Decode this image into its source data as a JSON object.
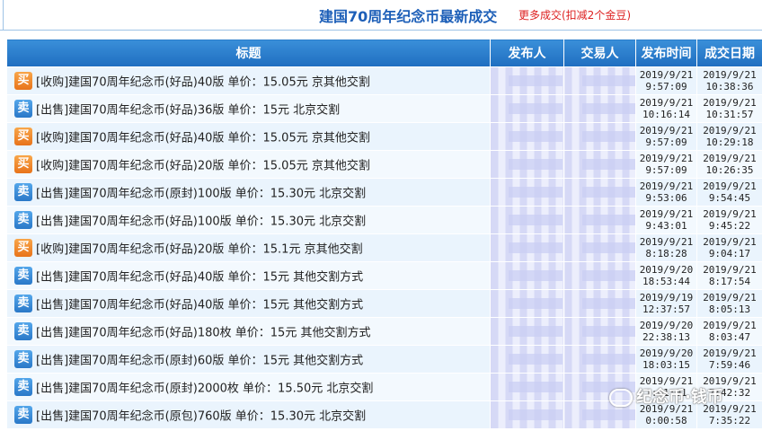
{
  "header": {
    "title": "建国70周年纪念币最新成交",
    "more": "更多成交(扣减2个金豆)"
  },
  "columns": [
    "标题",
    "发布人",
    "交易人",
    "发布时间",
    "成交日期"
  ],
  "rows": [
    {
      "type": "买",
      "badge": "buy",
      "title": "[收购]建国70周年纪念币(好品)40版 单价：15.05元 京其他交割",
      "pub_date": "2019/9/21",
      "pub_time": "9:57:09",
      "deal_date": "2019/9/21",
      "deal_time": "10:38:36"
    },
    {
      "type": "卖",
      "badge": "sell",
      "title": "[出售]建国70周年纪念币(好品)36版 单价：15元 北京交割",
      "pub_date": "2019/9/21",
      "pub_time": "10:16:14",
      "deal_date": "2019/9/21",
      "deal_time": "10:31:57"
    },
    {
      "type": "买",
      "badge": "buy",
      "title": "[收购]建国70周年纪念币(好品)40版 单价：15.05元 京其他交割",
      "pub_date": "2019/9/21",
      "pub_time": "9:57:09",
      "deal_date": "2019/9/21",
      "deal_time": "10:29:18"
    },
    {
      "type": "买",
      "badge": "buy",
      "title": "[收购]建国70周年纪念币(好品)20版 单价：15.05元 京其他交割",
      "pub_date": "2019/9/21",
      "pub_time": "9:57:09",
      "deal_date": "2019/9/21",
      "deal_time": "10:26:35"
    },
    {
      "type": "卖",
      "badge": "sell",
      "title": "[出售]建国70周年纪念币(原封)100版 单价：15.30元 北京交割",
      "pub_date": "2019/9/21",
      "pub_time": "9:53:06",
      "deal_date": "2019/9/21",
      "deal_time": "9:54:45"
    },
    {
      "type": "卖",
      "badge": "sell",
      "title": "[出售]建国70周年纪念币(好品)100版 单价：15.30元 北京交割",
      "pub_date": "2019/9/21",
      "pub_time": "9:43:01",
      "deal_date": "2019/9/21",
      "deal_time": "9:45:22"
    },
    {
      "type": "买",
      "badge": "buy",
      "title": "[收购]建国70周年纪念币(好品)20版 单价：15.1元 京其他交割",
      "pub_date": "2019/9/21",
      "pub_time": "8:18:28",
      "deal_date": "2019/9/21",
      "deal_time": "9:04:17"
    },
    {
      "type": "卖",
      "badge": "sell",
      "title": "[出售]建国70周年纪念币(好品)40版 单价：15元 其他交割方式",
      "pub_date": "2019/9/20",
      "pub_time": "18:53:44",
      "deal_date": "2019/9/21",
      "deal_time": "8:17:54"
    },
    {
      "type": "卖",
      "badge": "sell",
      "title": "[出售]建国70周年纪念币(好品)40版 单价：15元 其他交割方式",
      "pub_date": "2019/9/19",
      "pub_time": "12:37:57",
      "deal_date": "2019/9/21",
      "deal_time": "8:05:13"
    },
    {
      "type": "卖",
      "badge": "sell",
      "title": "[出售]建国70周年纪念币(好品)180枚 单价：15元 其他交割方式",
      "pub_date": "2019/9/20",
      "pub_time": "22:38:13",
      "deal_date": "2019/9/21",
      "deal_time": "8:03:47"
    },
    {
      "type": "卖",
      "badge": "sell",
      "title": "[出售]建国70周年纪念币(原封)60版 单价：15元 其他交割方式",
      "pub_date": "2019/9/20",
      "pub_time": "18:03:15",
      "deal_date": "2019/9/21",
      "deal_time": "7:59:46"
    },
    {
      "type": "卖",
      "badge": "sell",
      "title": "[出售]建国70周年纪念币(原封)2000枚 单价：15.50元 北京交割",
      "pub_date": "2019/9/21",
      "pub_time": "1:01:01",
      "deal_date": "2019/9/21",
      "deal_time": "7:42:32"
    },
    {
      "type": "卖",
      "badge": "sell",
      "title": "[出售]建国70周年纪念币(原包)760版 单价：15.30元 北京交割",
      "pub_date": "2019/9/21",
      "pub_time": "0:00:58",
      "deal_date": "2019/9/21",
      "deal_time": "7:35:22"
    }
  ],
  "watermark": "纪念币·钱币",
  "colors": {
    "header_blue": "#1f6ec0",
    "title_blue": "#1d5fb8",
    "link_red": "#dd2222",
    "buy_orange": "#e8731a",
    "sell_blue": "#2a78c8"
  }
}
